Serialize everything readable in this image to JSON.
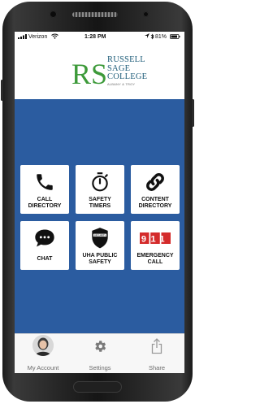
{
  "status_bar": {
    "carrier": "Verizon",
    "time": "1:28 PM",
    "battery": "81%"
  },
  "logo": {
    "monogram": "RS",
    "line1": "RUSSELL",
    "line2": "SAGE",
    "line3": "COLLEGE",
    "tagline": "ALBANY & TROY"
  },
  "tiles": [
    {
      "label1": "CALL",
      "label2": "DIRECTORY",
      "icon": "phone-icon"
    },
    {
      "label1": "SAFETY",
      "label2": "TIMERS",
      "icon": "stopwatch-icon"
    },
    {
      "label1": "CONTENT",
      "label2": "DIRECTORY",
      "icon": "link-icon"
    },
    {
      "label1": "CHAT",
      "label2": "",
      "icon": "chat-bubble-icon"
    },
    {
      "label1": "UHA PUBLIC",
      "label2": "SAFETY",
      "icon": "security-badge-icon"
    },
    {
      "label1": "EMERGENCY",
      "label2": "CALL",
      "icon": "911-icon",
      "badge_text": "911"
    }
  ],
  "tabbar": [
    {
      "label": "My Account",
      "icon": "avatar"
    },
    {
      "label": "Settings",
      "icon": "gear-icon"
    },
    {
      "label": "Share",
      "icon": "share-icon"
    }
  ],
  "colors": {
    "brand_blue": "#2b5ca0",
    "logo_green": "#3d9a3a",
    "logo_navy": "#1f5d7a",
    "emergency_red": "#d42a2a"
  }
}
